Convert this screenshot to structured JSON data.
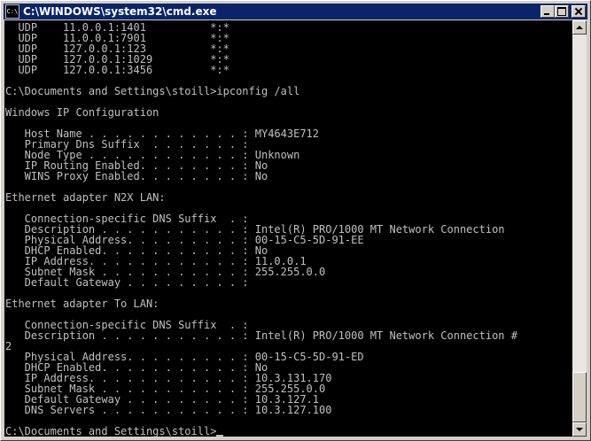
{
  "window": {
    "title": "C:\\WINDOWS\\system32\\cmd.exe",
    "icon_text": "C:\\"
  },
  "console": {
    "colors": {
      "background": "#000000",
      "text": "#c0c0c0"
    },
    "lines": [
      "  UDP    11.0.0.1:1401          *:*",
      "  UDP    11.0.0.1:7901          *:*",
      "  UDP    127.0.0.1:123          *:*",
      "  UDP    127.0.0.1:1029         *:*",
      "  UDP    127.0.0.1:3456         *:*",
      "",
      "C:\\Documents and Settings\\stoill>ipconfig /all",
      "",
      "Windows IP Configuration",
      "",
      "   Host Name . . . . . . . . . . . . : MY4643E712",
      "   Primary Dns Suffix  . . . . . . . :",
      "   Node Type . . . . . . . . . . . . : Unknown",
      "   IP Routing Enabled. . . . . . . . : No",
      "   WINS Proxy Enabled. . . . . . . . : No",
      "",
      "Ethernet adapter N2X LAN:",
      "",
      "   Connection-specific DNS Suffix  . :",
      "   Description . . . . . . . . . . . : Intel(R) PRO/1000 MT Network Connection",
      "   Physical Address. . . . . . . . . : 00-15-C5-5D-91-EE",
      "   DHCP Enabled. . . . . . . . . . . : No",
      "   IP Address. . . . . . . . . . . . : 11.0.0.1",
      "   Subnet Mask . . . . . . . . . . . : 255.255.0.0",
      "   Default Gateway . . . . . . . . . :",
      "",
      "Ethernet adapter To LAN:",
      "",
      "   Connection-specific DNS Suffix  . :",
      "   Description . . . . . . . . . . . : Intel(R) PRO/1000 MT Network Connection #",
      "2",
      "   Physical Address. . . . . . . . . : 00-15-C5-5D-91-ED",
      "   DHCP Enabled. . . . . . . . . . . : No",
      "   IP Address. . . . . . . . . . . . : 10.3.131.170",
      "   Subnet Mask . . . . . . . . . . . : 255.255.0.0",
      "   Default Gateway . . . . . . . . . : 10.3.127.1",
      "   DNS Servers . . . . . . . . . . . : 10.3.127.100",
      "",
      "C:\\Documents and Settings\\stoill>"
    ]
  }
}
